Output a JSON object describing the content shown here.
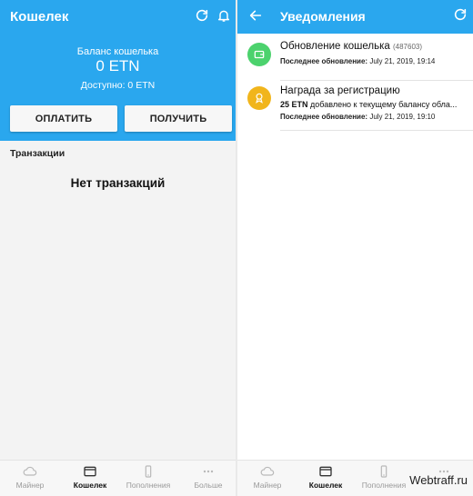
{
  "colors": {
    "primary": "#2aa7ee",
    "green": "#4cd26d",
    "gold": "#f1b51c"
  },
  "wallet": {
    "title": "Кошелек",
    "icons": [
      "refresh-icon",
      "bell-icon"
    ],
    "balance_label": "Баланс кошелька",
    "balance_amount": "0 ETN",
    "available": "Доступно: 0 ETN",
    "pay_button": "ОПЛАТИТЬ",
    "receive_button": "ПОЛУЧИТЬ",
    "transactions_header": "Транзакции",
    "empty_text": "Нет транзакций"
  },
  "nav": {
    "items": [
      {
        "label": "Майнер",
        "icon": "cloud-icon",
        "active": false
      },
      {
        "label": "Кошелек",
        "icon": "wallet-icon",
        "active": true
      },
      {
        "label": "Пополнения",
        "icon": "phone-icon",
        "active": false
      },
      {
        "label": "Больше",
        "icon": "more-dots-icon",
        "active": false
      }
    ]
  },
  "notifications": {
    "title": "Уведомления",
    "items": [
      {
        "title": "Обновление кошелька",
        "id": "(487603)",
        "date_label": "Последнее обновление:",
        "date": "July 21, 2019, 19:14",
        "icon": "wallet-icon",
        "color": "#4cd26d"
      },
      {
        "title": "Награда за регистрацию",
        "amount": "25 ETN",
        "message": "добавлено к текущему балансу обла...",
        "date_label": "Последнее обновление:",
        "date": "July 21, 2019, 19:10",
        "icon": "award-icon",
        "color": "#f1b51c"
      }
    ]
  },
  "watermark": "Webtraff.ru"
}
